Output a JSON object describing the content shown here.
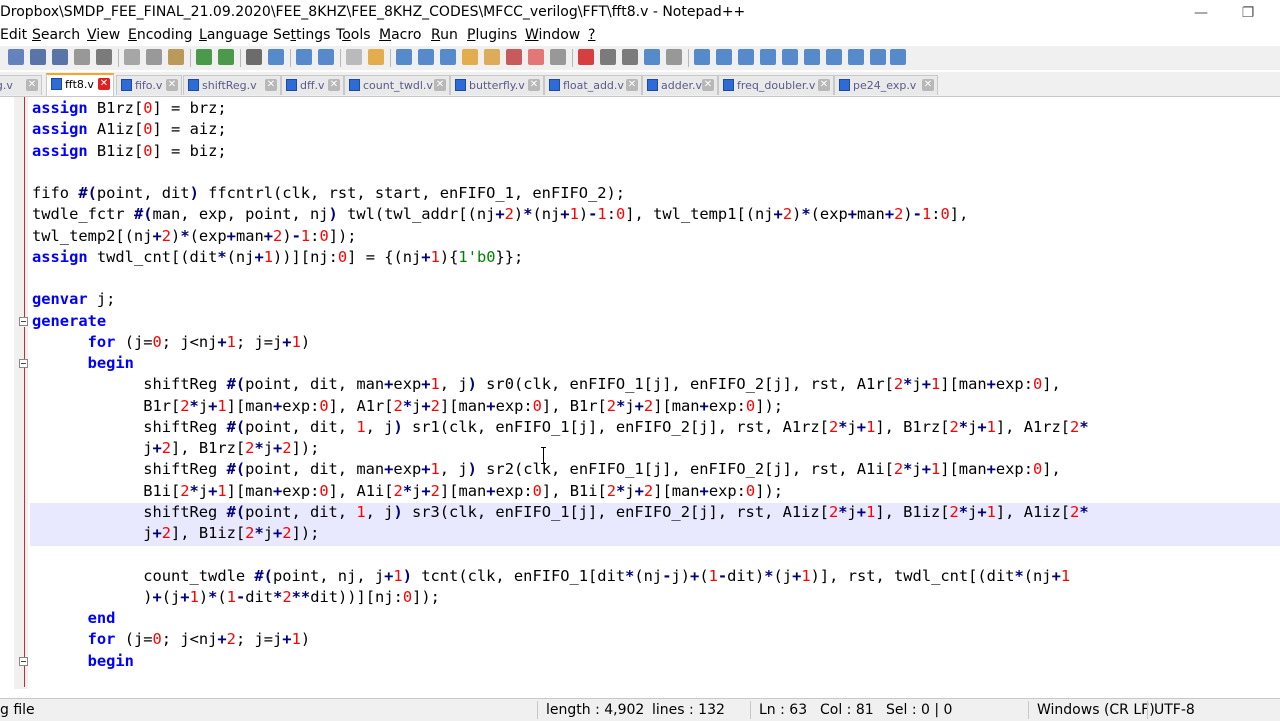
{
  "window": {
    "title": "Dropbox\\SMDP_FEE_FINAL_21.09.2020\\FEE_8KHZ\\FEE_8KHZ_CODES\\MFCC_verilog\\FFT\\fft8.v - Notepad++",
    "minimize_glyph": "—",
    "restore_glyph": "❐"
  },
  "menu": [
    {
      "pre": "",
      "u": "",
      "post": "Edit"
    },
    {
      "pre": "",
      "u": "S",
      "post": "earch"
    },
    {
      "pre": "",
      "u": "V",
      "post": "iew"
    },
    {
      "pre": "",
      "u": "E",
      "post": "ncoding"
    },
    {
      "pre": "",
      "u": "L",
      "post": "anguage"
    },
    {
      "pre": "Se",
      "u": "t",
      "post": "tings"
    },
    {
      "pre": "T",
      "u": "o",
      "post": "ols"
    },
    {
      "pre": "",
      "u": "M",
      "post": "acro"
    },
    {
      "pre": "",
      "u": "R",
      "post": "un"
    },
    {
      "pre": "",
      "u": "P",
      "post": "lugins"
    },
    {
      "pre": "",
      "u": "W",
      "post": "indow"
    },
    {
      "pre": "",
      "u": "?",
      "post": ""
    }
  ],
  "tabs": [
    {
      "label": "fig.v",
      "active": false
    },
    {
      "label": "fft8.v",
      "active": true
    },
    {
      "label": "fifo.v",
      "active": false
    },
    {
      "label": "shiftReg.v",
      "active": false
    },
    {
      "label": "dff.v",
      "active": false
    },
    {
      "label": "count_twdl.v",
      "active": false
    },
    {
      "label": "butterfly.v",
      "active": false
    },
    {
      "label": "float_add.v",
      "active": false
    },
    {
      "label": "adder.v",
      "active": false
    },
    {
      "label": "freq_doubler.v",
      "active": false
    },
    {
      "label": "pe24_exp.v",
      "active": false
    }
  ],
  "tab_close_glyph": "✕",
  "code_lines": [
    [
      [
        "kw",
        "assign"
      ],
      [
        "t",
        " B1rz["
      ],
      [
        "num",
        "0"
      ],
      [
        "t",
        "] = brz;"
      ]
    ],
    [
      [
        "kw",
        "assign"
      ],
      [
        "t",
        " A1iz["
      ],
      [
        "num",
        "0"
      ],
      [
        "t",
        "] = aiz;"
      ]
    ],
    [
      [
        "kw",
        "assign"
      ],
      [
        "t",
        " B1iz["
      ],
      [
        "num",
        "0"
      ],
      [
        "t",
        "] = biz;"
      ]
    ],
    [],
    [
      [
        "t",
        "fifo "
      ],
      [
        "op",
        "#("
      ],
      [
        "t",
        "point, dit"
      ],
      [
        "op",
        ")"
      ],
      [
        "t",
        " ffcntrl(clk, rst, start, enFIFO_1, enFIFO_2);"
      ]
    ],
    [
      [
        "t",
        "twdle_fctr "
      ],
      [
        "op",
        "#("
      ],
      [
        "t",
        "man, exp, point, nj"
      ],
      [
        "op",
        ")"
      ],
      [
        "t",
        " twl(twl_addr[(nj"
      ],
      [
        "op",
        "+"
      ],
      [
        "num",
        "2"
      ],
      [
        "t",
        ")"
      ],
      [
        "op",
        "*"
      ],
      [
        "t",
        "(nj"
      ],
      [
        "op",
        "+"
      ],
      [
        "num",
        "1"
      ],
      [
        "t",
        ")"
      ],
      [
        "op",
        "-"
      ],
      [
        "num",
        "1"
      ],
      [
        "t",
        ":"
      ],
      [
        "num",
        "0"
      ],
      [
        "t",
        "], twl_temp1[(nj"
      ],
      [
        "op",
        "+"
      ],
      [
        "num",
        "2"
      ],
      [
        "t",
        ")"
      ],
      [
        "op",
        "*"
      ],
      [
        "t",
        "(exp"
      ],
      [
        "op",
        "+"
      ],
      [
        "t",
        "man"
      ],
      [
        "op",
        "+"
      ],
      [
        "num",
        "2"
      ],
      [
        "t",
        ")"
      ],
      [
        "op",
        "-"
      ],
      [
        "num",
        "1"
      ],
      [
        "t",
        ":"
      ],
      [
        "num",
        "0"
      ],
      [
        "t",
        "],"
      ]
    ],
    [
      [
        "t",
        "twl_temp2[(nj"
      ],
      [
        "op",
        "+"
      ],
      [
        "num",
        "2"
      ],
      [
        "t",
        ")"
      ],
      [
        "op",
        "*"
      ],
      [
        "t",
        "(exp"
      ],
      [
        "op",
        "+"
      ],
      [
        "t",
        "man"
      ],
      [
        "op",
        "+"
      ],
      [
        "num",
        "2"
      ],
      [
        "t",
        ")"
      ],
      [
        "op",
        "-"
      ],
      [
        "num",
        "1"
      ],
      [
        "t",
        ":"
      ],
      [
        "num",
        "0"
      ],
      [
        "t",
        "]);"
      ]
    ],
    [
      [
        "kw",
        "assign"
      ],
      [
        "t",
        " twdl_cnt[(dit"
      ],
      [
        "op",
        "*"
      ],
      [
        "t",
        "(nj"
      ],
      [
        "op",
        "+"
      ],
      [
        "num",
        "1"
      ],
      [
        "t",
        "))][nj:"
      ],
      [
        "num",
        "0"
      ],
      [
        "t",
        "] = {(nj"
      ],
      [
        "op",
        "+"
      ],
      [
        "num",
        "1"
      ],
      [
        "t",
        ")"
      ],
      [
        "t",
        "{"
      ],
      [
        "num2",
        "1'b0"
      ],
      [
        "t",
        "}};"
      ]
    ],
    [],
    [
      [
        "kw",
        "genvar"
      ],
      [
        "t",
        " j;"
      ]
    ],
    [
      [
        "kw",
        "generate"
      ]
    ],
    [
      [
        "t",
        "      "
      ],
      [
        "kw",
        "for"
      ],
      [
        "t",
        " (j="
      ],
      [
        "num",
        "0"
      ],
      [
        "t",
        "; j<nj"
      ],
      [
        "op",
        "+"
      ],
      [
        "num",
        "1"
      ],
      [
        "t",
        "; j=j"
      ],
      [
        "op",
        "+"
      ],
      [
        "num",
        "1"
      ],
      [
        "t",
        ")"
      ]
    ],
    [
      [
        "t",
        "      "
      ],
      [
        "kw",
        "begin"
      ]
    ],
    [
      [
        "t",
        "            shiftReg "
      ],
      [
        "op",
        "#("
      ],
      [
        "t",
        "point, dit, man"
      ],
      [
        "op",
        "+"
      ],
      [
        "t",
        "exp"
      ],
      [
        "op",
        "+"
      ],
      [
        "num",
        "1"
      ],
      [
        "t",
        ", j"
      ],
      [
        "op",
        ")"
      ],
      [
        "t",
        " sr0(clk, enFIFO_1[j], enFIFO_2[j], rst, A1r["
      ],
      [
        "num",
        "2"
      ],
      [
        "op",
        "*"
      ],
      [
        "t",
        "j"
      ],
      [
        "op",
        "+"
      ],
      [
        "num",
        "1"
      ],
      [
        "t",
        "][man"
      ],
      [
        "op",
        "+"
      ],
      [
        "t",
        "exp:"
      ],
      [
        "num",
        "0"
      ],
      [
        "t",
        "],"
      ]
    ],
    [
      [
        "t",
        "            B1r["
      ],
      [
        "num",
        "2"
      ],
      [
        "op",
        "*"
      ],
      [
        "t",
        "j"
      ],
      [
        "op",
        "+"
      ],
      [
        "num",
        "1"
      ],
      [
        "t",
        "][man"
      ],
      [
        "op",
        "+"
      ],
      [
        "t",
        "exp:"
      ],
      [
        "num",
        "0"
      ],
      [
        "t",
        "], A1r["
      ],
      [
        "num",
        "2"
      ],
      [
        "op",
        "*"
      ],
      [
        "t",
        "j"
      ],
      [
        "op",
        "+"
      ],
      [
        "num",
        "2"
      ],
      [
        "t",
        "][man"
      ],
      [
        "op",
        "+"
      ],
      [
        "t",
        "exp:"
      ],
      [
        "num",
        "0"
      ],
      [
        "t",
        "], B1r["
      ],
      [
        "num",
        "2"
      ],
      [
        "op",
        "*"
      ],
      [
        "t",
        "j"
      ],
      [
        "op",
        "+"
      ],
      [
        "num",
        "2"
      ],
      [
        "t",
        "][man"
      ],
      [
        "op",
        "+"
      ],
      [
        "t",
        "exp:"
      ],
      [
        "num",
        "0"
      ],
      [
        "t",
        "]);"
      ]
    ],
    [
      [
        "t",
        "            shiftReg "
      ],
      [
        "op",
        "#("
      ],
      [
        "t",
        "point, dit, "
      ],
      [
        "num",
        "1"
      ],
      [
        "t",
        ", j"
      ],
      [
        "op",
        ")"
      ],
      [
        "t",
        " sr1(clk, enFIFO_1[j], enFIFO_2[j], rst, A1rz["
      ],
      [
        "num",
        "2"
      ],
      [
        "op",
        "*"
      ],
      [
        "t",
        "j"
      ],
      [
        "op",
        "+"
      ],
      [
        "num",
        "1"
      ],
      [
        "t",
        "], B1rz["
      ],
      [
        "num",
        "2"
      ],
      [
        "op",
        "*"
      ],
      [
        "t",
        "j"
      ],
      [
        "op",
        "+"
      ],
      [
        "num",
        "1"
      ],
      [
        "t",
        "], A1rz["
      ],
      [
        "num",
        "2"
      ],
      [
        "op",
        "*"
      ]
    ],
    [
      [
        "t",
        "            j"
      ],
      [
        "op",
        "+"
      ],
      [
        "num",
        "2"
      ],
      [
        "t",
        "], B1rz["
      ],
      [
        "num",
        "2"
      ],
      [
        "op",
        "*"
      ],
      [
        "t",
        "j"
      ],
      [
        "op",
        "+"
      ],
      [
        "num",
        "2"
      ],
      [
        "t",
        "]);"
      ]
    ],
    [
      [
        "t",
        "            shiftReg "
      ],
      [
        "op",
        "#("
      ],
      [
        "t",
        "point, dit, man"
      ],
      [
        "op",
        "+"
      ],
      [
        "t",
        "exp"
      ],
      [
        "op",
        "+"
      ],
      [
        "num",
        "1"
      ],
      [
        "t",
        ", j"
      ],
      [
        "op",
        ")"
      ],
      [
        "t",
        " sr2(clk, enFIFO_1[j], enFIFO_2[j], rst, A1i["
      ],
      [
        "num",
        "2"
      ],
      [
        "op",
        "*"
      ],
      [
        "t",
        "j"
      ],
      [
        "op",
        "+"
      ],
      [
        "num",
        "1"
      ],
      [
        "t",
        "][man"
      ],
      [
        "op",
        "+"
      ],
      [
        "t",
        "exp:"
      ],
      [
        "num",
        "0"
      ],
      [
        "t",
        "],"
      ]
    ],
    [
      [
        "t",
        "            B1i["
      ],
      [
        "num",
        "2"
      ],
      [
        "op",
        "*"
      ],
      [
        "t",
        "j"
      ],
      [
        "op",
        "+"
      ],
      [
        "num",
        "1"
      ],
      [
        "t",
        "][man"
      ],
      [
        "op",
        "+"
      ],
      [
        "t",
        "exp:"
      ],
      [
        "num",
        "0"
      ],
      [
        "t",
        "], A1i["
      ],
      [
        "num",
        "2"
      ],
      [
        "op",
        "*"
      ],
      [
        "t",
        "j"
      ],
      [
        "op",
        "+"
      ],
      [
        "num",
        "2"
      ],
      [
        "t",
        "][man"
      ],
      [
        "op",
        "+"
      ],
      [
        "t",
        "exp:"
      ],
      [
        "num",
        "0"
      ],
      [
        "t",
        "], B1i["
      ],
      [
        "num",
        "2"
      ],
      [
        "op",
        "*"
      ],
      [
        "t",
        "j"
      ],
      [
        "op",
        "+"
      ],
      [
        "num",
        "2"
      ],
      [
        "t",
        "][man"
      ],
      [
        "op",
        "+"
      ],
      [
        "t",
        "exp:"
      ],
      [
        "num",
        "0"
      ],
      [
        "t",
        "]);"
      ]
    ],
    [
      [
        "t",
        "            shiftReg "
      ],
      [
        "op",
        "#("
      ],
      [
        "t",
        "point, dit, "
      ],
      [
        "num",
        "1"
      ],
      [
        "t",
        ", j"
      ],
      [
        "op",
        ")"
      ],
      [
        "t",
        " sr3(clk, enFIFO_1[j], enFIFO_2[j], rst, A1iz["
      ],
      [
        "num",
        "2"
      ],
      [
        "op",
        "*"
      ],
      [
        "t",
        "j"
      ],
      [
        "op",
        "+"
      ],
      [
        "num",
        "1"
      ],
      [
        "t",
        "], B1iz["
      ],
      [
        "num",
        "2"
      ],
      [
        "op",
        "*"
      ],
      [
        "t",
        "j"
      ],
      [
        "op",
        "+"
      ],
      [
        "num",
        "1"
      ],
      [
        "t",
        "], A1iz["
      ],
      [
        "num",
        "2"
      ],
      [
        "op",
        "*"
      ]
    ],
    [
      [
        "t",
        "            j"
      ],
      [
        "op",
        "+"
      ],
      [
        "num",
        "2"
      ],
      [
        "t",
        "], B1iz["
      ],
      [
        "num",
        "2"
      ],
      [
        "op",
        "*"
      ],
      [
        "t",
        "j"
      ],
      [
        "op",
        "+"
      ],
      [
        "num",
        "2"
      ],
      [
        "t",
        "]);"
      ]
    ],
    [],
    [
      [
        "t",
        "            count_twdle "
      ],
      [
        "op",
        "#("
      ],
      [
        "t",
        "point, nj, j"
      ],
      [
        "op",
        "+"
      ],
      [
        "num",
        "1"
      ],
      [
        "op",
        ")"
      ],
      [
        "t",
        " tcnt(clk, enFIFO_1[dit"
      ],
      [
        "op",
        "*"
      ],
      [
        "t",
        "(nj"
      ],
      [
        "op",
        "-"
      ],
      [
        "t",
        "j)"
      ],
      [
        "op",
        "+"
      ],
      [
        "t",
        "("
      ],
      [
        "num",
        "1"
      ],
      [
        "op",
        "-"
      ],
      [
        "t",
        "dit)"
      ],
      [
        "op",
        "*"
      ],
      [
        "t",
        "(j"
      ],
      [
        "op",
        "+"
      ],
      [
        "num",
        "1"
      ],
      [
        "t",
        ")], rst, twdl_cnt[(dit"
      ],
      [
        "op",
        "*"
      ],
      [
        "t",
        "(nj"
      ],
      [
        "op",
        "+"
      ],
      [
        "num",
        "1"
      ]
    ],
    [
      [
        "t",
        "            )"
      ],
      [
        "op",
        "+"
      ],
      [
        "t",
        "(j"
      ],
      [
        "op",
        "+"
      ],
      [
        "num",
        "1"
      ],
      [
        "t",
        ")"
      ],
      [
        "op",
        "*"
      ],
      [
        "t",
        "("
      ],
      [
        "num",
        "1"
      ],
      [
        "op",
        "-"
      ],
      [
        "t",
        "dit"
      ],
      [
        "op",
        "*"
      ],
      [
        "num",
        "2"
      ],
      [
        "op",
        "**"
      ],
      [
        "t",
        "dit))][nj:"
      ],
      [
        "num",
        "0"
      ],
      [
        "t",
        "]);"
      ]
    ],
    [
      [
        "t",
        "      "
      ],
      [
        "kw",
        "end"
      ]
    ],
    [
      [
        "t",
        "      "
      ],
      [
        "kw",
        "for"
      ],
      [
        "t",
        " (j="
      ],
      [
        "num",
        "0"
      ],
      [
        "t",
        "; j<nj"
      ],
      [
        "op",
        "+"
      ],
      [
        "num",
        "2"
      ],
      [
        "t",
        "; j=j"
      ],
      [
        "op",
        "+"
      ],
      [
        "num",
        "1"
      ],
      [
        "t",
        ")"
      ]
    ],
    [
      [
        "t",
        "      "
      ],
      [
        "kw",
        "begin"
      ]
    ]
  ],
  "status": {
    "file_type": "g file",
    "length": "length : 4,902",
    "lines": "lines : 132",
    "ln": "Ln : 63",
    "col": "Col : 81",
    "sel": "Sel : 0 | 0",
    "eol": "Windows (CR LF)",
    "encoding": "UTF-8"
  },
  "colors": {
    "keyword": "#0000ff",
    "operator": "#000080",
    "number": "#ff0000",
    "current_line": "#e8e8ff",
    "active_tab_close": "#e02020"
  }
}
